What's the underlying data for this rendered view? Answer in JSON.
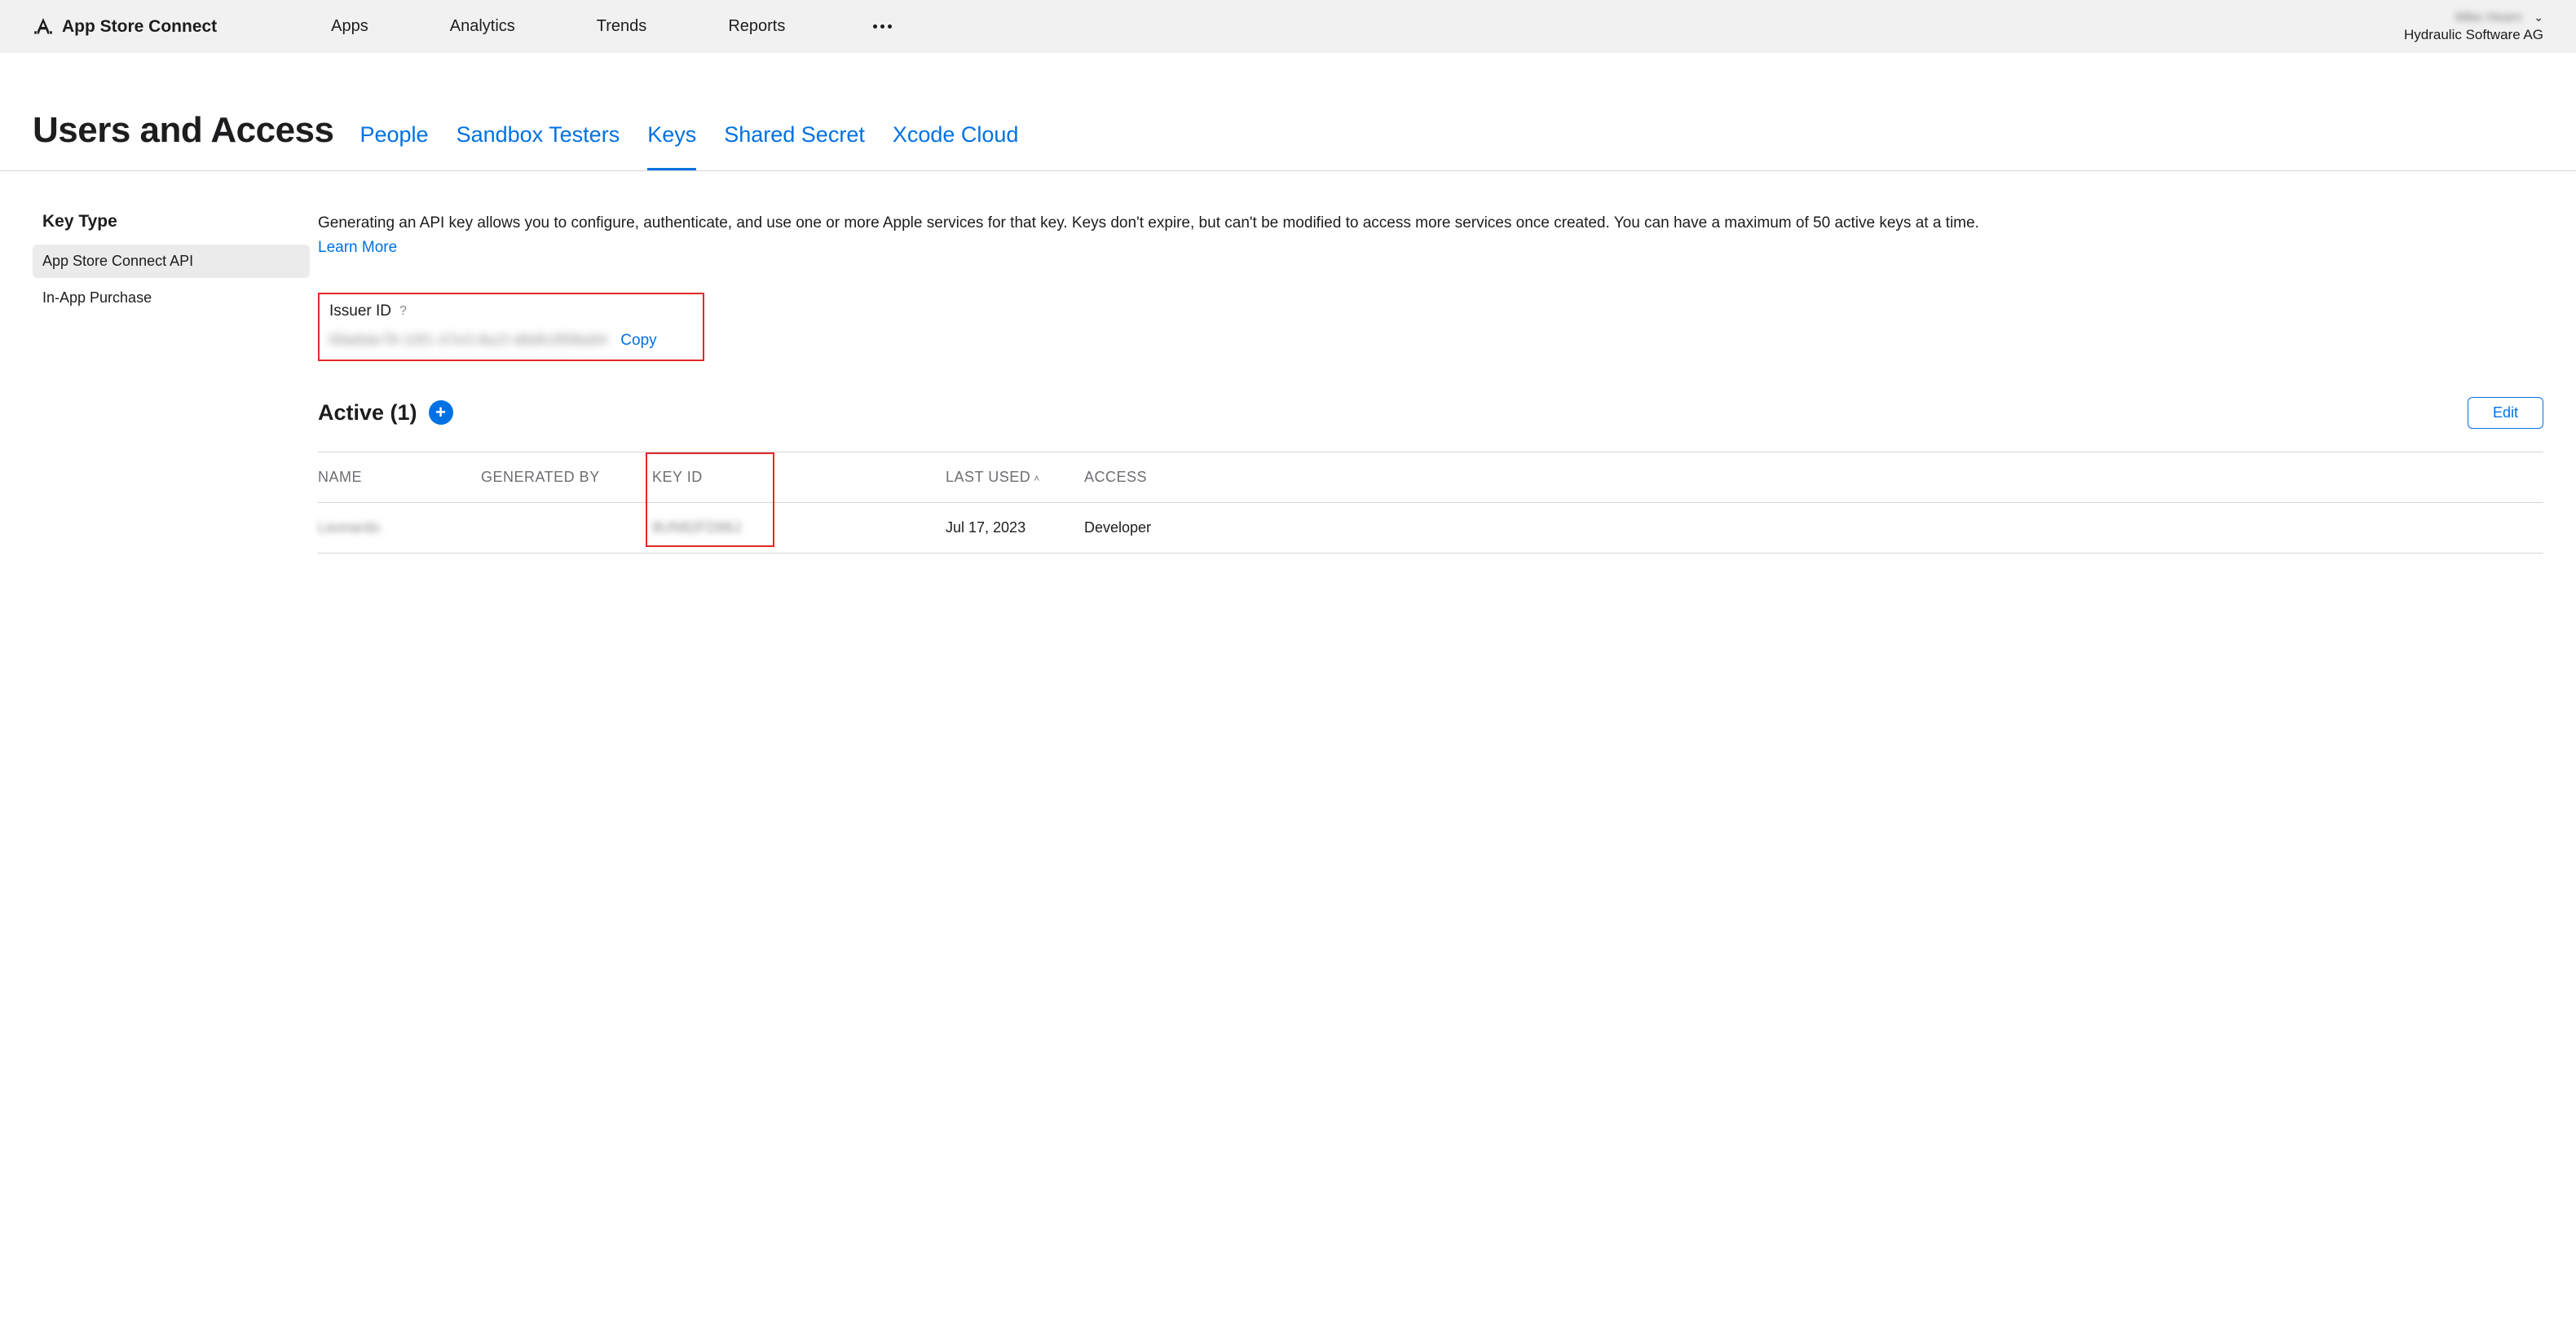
{
  "header": {
    "brand": "App Store Connect",
    "nav": [
      "Apps",
      "Analytics",
      "Trends",
      "Reports"
    ],
    "account_name": "Mike Hearn",
    "account_company": "Hydraulic Software AG"
  },
  "page": {
    "title": "Users and Access",
    "tabs": [
      "People",
      "Sandbox Testers",
      "Keys",
      "Shared Secret",
      "Xcode Cloud"
    ],
    "active_tab": "Keys"
  },
  "sidebar": {
    "title": "Key Type",
    "items": [
      "App Store Connect API",
      "In-App Purchase"
    ],
    "active_index": 0
  },
  "main": {
    "description": "Generating an API key allows you to configure, authenticate, and use one or more Apple services for that key. Keys don't expire, but can't be modified to access more services once created. You can have a maximum of 50 active keys at a time.",
    "learn_more": "Learn More",
    "issuer": {
      "label": "Issuer ID",
      "value": "69a6de78-10f1-47e3-8a1f-d8dfc0f08a94",
      "copy": "Copy"
    },
    "active_section": {
      "title": "Active (1)",
      "edit": "Edit"
    },
    "table": {
      "columns": {
        "name": "NAME",
        "generated_by": "GENERATED BY",
        "key_id": "KEY ID",
        "last_used": "LAST USED",
        "access": "ACCESS"
      },
      "rows": [
        {
          "name": "Leonardo",
          "generated_by": "",
          "key_id": "8UN82FD86J",
          "last_used": "Jul 17, 2023",
          "access": "Developer"
        }
      ]
    }
  }
}
